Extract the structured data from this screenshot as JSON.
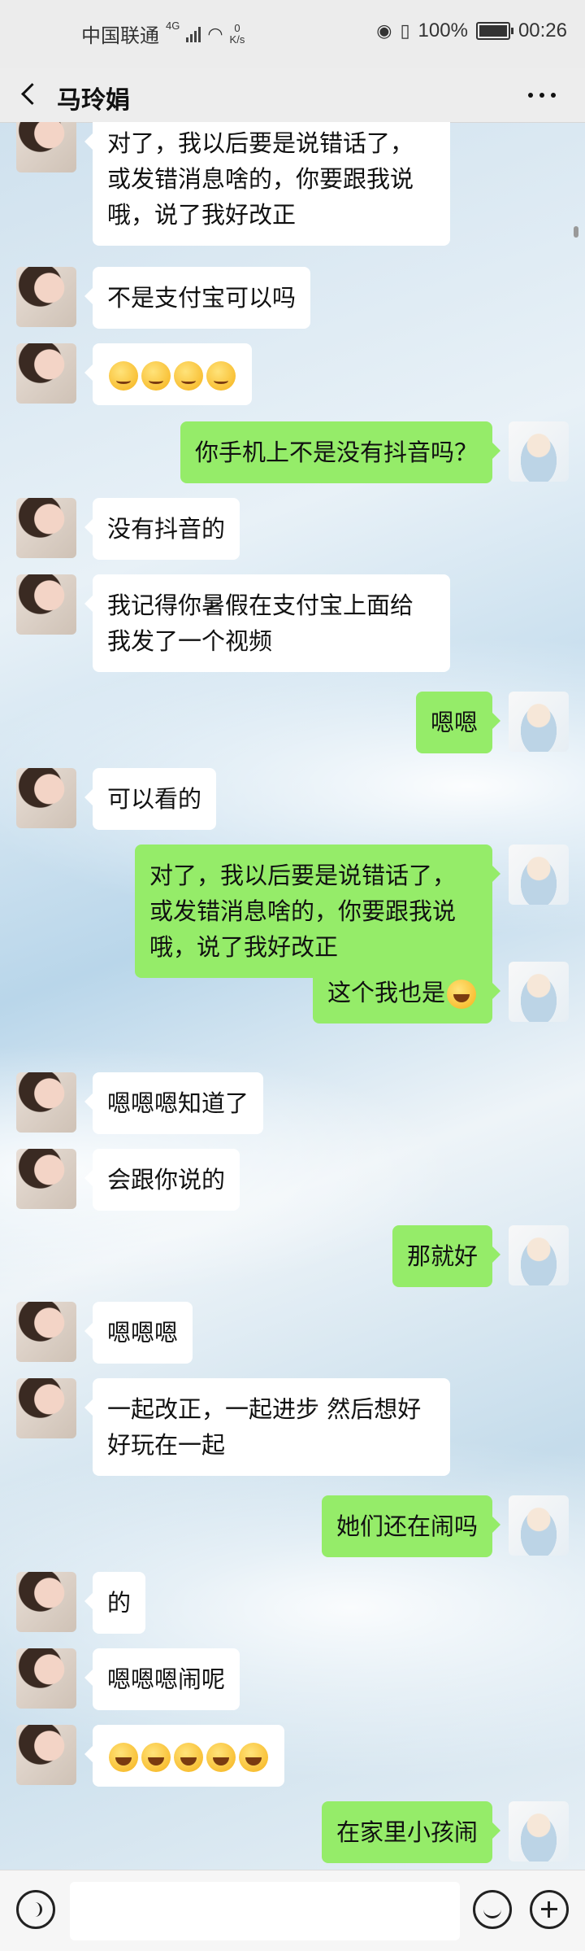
{
  "status_bar": {
    "carrier": "中国联通",
    "network": "4G",
    "speed_value": "0",
    "speed_unit": "K/s",
    "battery": "100%",
    "time": "00:26"
  },
  "header": {
    "contact_name": "马玲娟"
  },
  "messages": [
    {
      "from": "them",
      "text": "对了，我以后要是说错话了，或发错消息啥的，你要跟我说哦，说了我好改正"
    },
    {
      "from": "them",
      "text": "不是支付宝可以吗"
    },
    {
      "from": "them",
      "text": "",
      "emojis": [
        "blush",
        "blush",
        "blush",
        "blush"
      ]
    },
    {
      "from": "me",
      "text": "你手机上不是没有抖音吗？"
    },
    {
      "from": "them",
      "text": "没有抖音的"
    },
    {
      "from": "them",
      "text": "我记得你暑假在支付宝上面给我发了一个视频"
    },
    {
      "from": "me",
      "text": "嗯嗯"
    },
    {
      "from": "them",
      "text": "可以看的"
    },
    {
      "from": "me",
      "text": "对了，我以后要是说错话了，或发错消息啥的，你要跟我说哦，说了我好改正"
    },
    {
      "from": "me",
      "text": "这个我也是",
      "emojis": [
        "laugh"
      ]
    },
    {
      "from": "them",
      "text": "嗯嗯嗯知道了"
    },
    {
      "from": "them",
      "text": "会跟你说的"
    },
    {
      "from": "me",
      "text": "那就好"
    },
    {
      "from": "them",
      "text": "嗯嗯嗯"
    },
    {
      "from": "them",
      "text": "一起改正，一起进步 然后想好好玩在一起"
    },
    {
      "from": "me",
      "text": "她们还在闹吗"
    },
    {
      "from": "them",
      "text": "的"
    },
    {
      "from": "them",
      "text": "嗯嗯嗯闹呢"
    },
    {
      "from": "them",
      "text": "",
      "emojis": [
        "laugh",
        "laugh",
        "laugh",
        "laugh",
        "laugh"
      ]
    },
    {
      "from": "me",
      "text": "在家里小孩闹"
    }
  ],
  "input_bar": {
    "placeholder": ""
  },
  "colors": {
    "my_bubble": "#95ec69",
    "their_bubble": "#ffffff"
  }
}
